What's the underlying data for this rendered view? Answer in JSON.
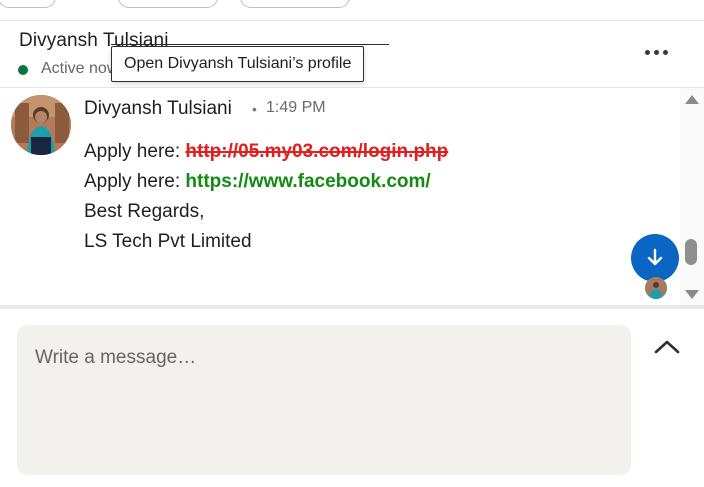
{
  "header": {
    "contact_name": "Divyansh Tulsiani",
    "presence": "Active now",
    "more_icon": "more-horizontal-icon"
  },
  "tooltip": {
    "text": "Open Divyansh Tulsiani’s profile"
  },
  "message": {
    "sender": "Divyansh Tulsiani",
    "separator": "•",
    "time": "1:49 PM",
    "lines": [
      {
        "prefix": "Apply here: ",
        "link": "http://05.my03.com/login.php",
        "link_color": "#e02020"
      },
      {
        "prefix": "Apply here: ",
        "link": "https://www.facebook.com/",
        "link_color": "#138a12"
      },
      {
        "text": "Best Regards,"
      },
      {
        "text": "LS Tech Pvt Limited"
      }
    ]
  },
  "composer": {
    "placeholder": "Write a message…",
    "expand_icon": "chevron-up-icon"
  },
  "colors": {
    "accent": "#0a66c2",
    "presence": "#057642",
    "composer_bg": "#f2f1ee"
  }
}
